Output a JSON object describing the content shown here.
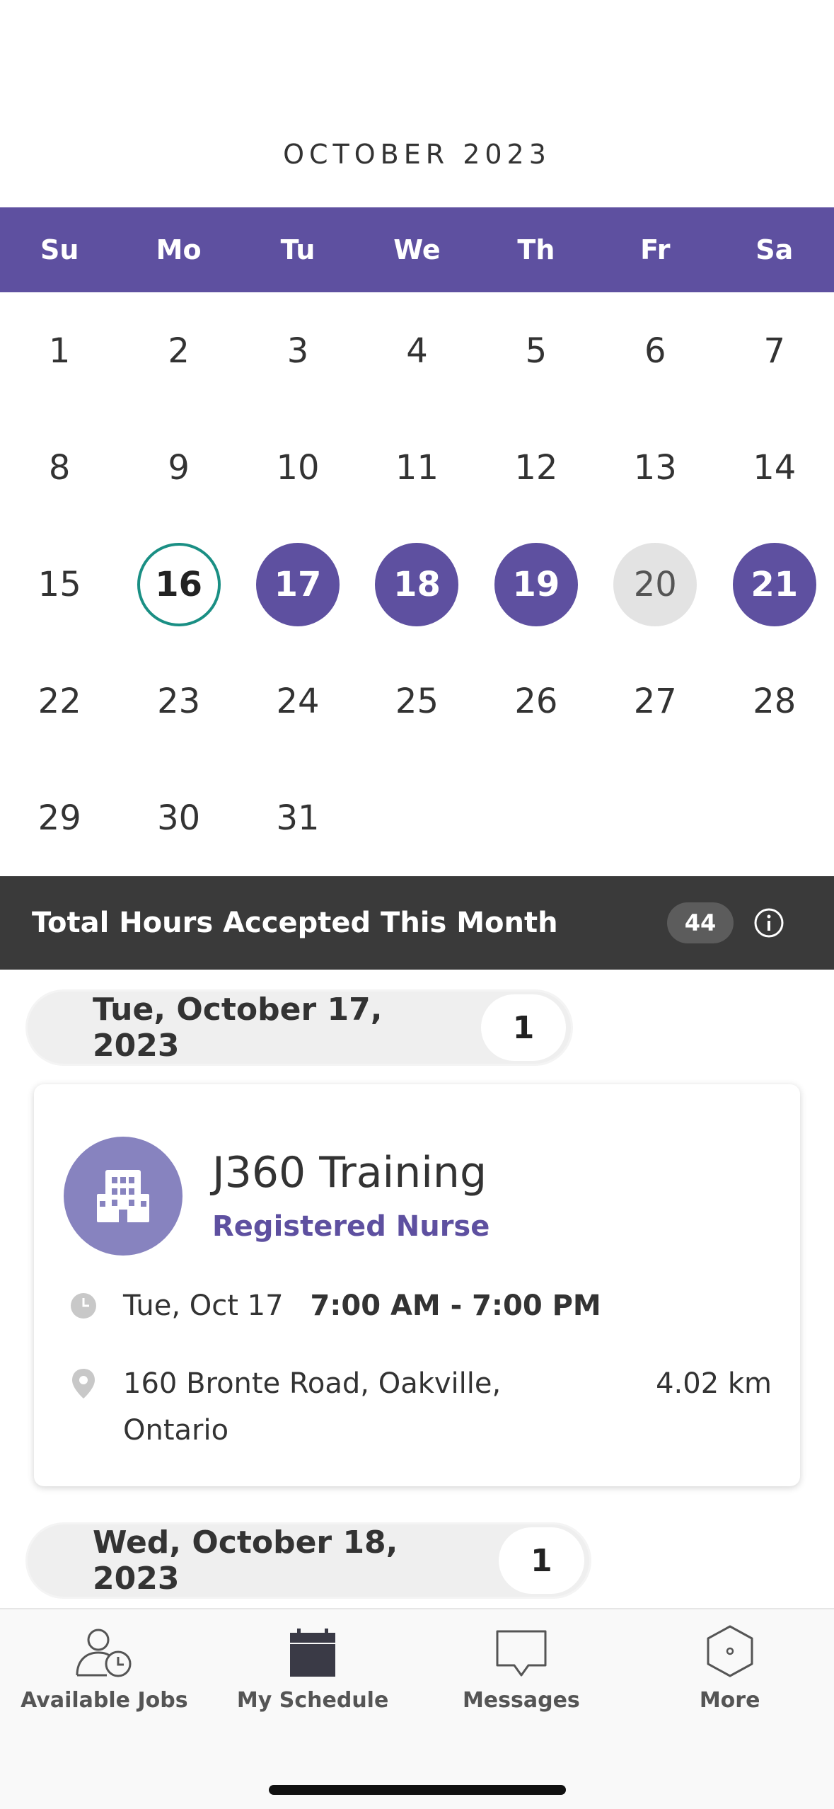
{
  "calendar": {
    "month_title": "OCTOBER 2023",
    "weekdays": [
      "Su",
      "Mo",
      "Tu",
      "We",
      "Th",
      "Fr",
      "Sa"
    ],
    "weeks": [
      [
        {
          "day": "1",
          "state": "none"
        },
        {
          "day": "2",
          "state": "none"
        },
        {
          "day": "3",
          "state": "none"
        },
        {
          "day": "4",
          "state": "none"
        },
        {
          "day": "5",
          "state": "none"
        },
        {
          "day": "6",
          "state": "none"
        },
        {
          "day": "7",
          "state": "none"
        }
      ],
      [
        {
          "day": "8",
          "state": "none"
        },
        {
          "day": "9",
          "state": "none"
        },
        {
          "day": "10",
          "state": "none"
        },
        {
          "day": "11",
          "state": "none"
        },
        {
          "day": "12",
          "state": "none"
        },
        {
          "day": "13",
          "state": "none"
        },
        {
          "day": "14",
          "state": "none"
        }
      ],
      [
        {
          "day": "15",
          "state": "none"
        },
        {
          "day": "16",
          "state": "today"
        },
        {
          "day": "17",
          "state": "booked"
        },
        {
          "day": "18",
          "state": "booked"
        },
        {
          "day": "19",
          "state": "booked"
        },
        {
          "day": "20",
          "state": "gray"
        },
        {
          "day": "21",
          "state": "booked"
        }
      ],
      [
        {
          "day": "22",
          "state": "none"
        },
        {
          "day": "23",
          "state": "none"
        },
        {
          "day": "24",
          "state": "none"
        },
        {
          "day": "25",
          "state": "none"
        },
        {
          "day": "26",
          "state": "none"
        },
        {
          "day": "27",
          "state": "none"
        },
        {
          "day": "28",
          "state": "none"
        }
      ],
      [
        {
          "day": "29",
          "state": "none"
        },
        {
          "day": "30",
          "state": "none"
        },
        {
          "day": "31",
          "state": "none"
        },
        {
          "day": "",
          "state": "empty"
        },
        {
          "day": "",
          "state": "empty"
        },
        {
          "day": "",
          "state": "empty"
        },
        {
          "day": "",
          "state": "empty"
        }
      ]
    ]
  },
  "hours_summary": {
    "label": "Total Hours Accepted This Month",
    "value": "44",
    "info_icon": "info-icon"
  },
  "schedule": {
    "groups": [
      {
        "date_label": "Tue, October 17, 2023",
        "count": "1",
        "shift": {
          "facility": "J360 Training",
          "role": "Registered Nurse",
          "date": "Tue, Oct 17",
          "time_range": "7:00 AM - 7:00 PM",
          "address": "160 Bronte Road, Oakville, Ontario",
          "distance": "4.02 km"
        }
      },
      {
        "date_label": "Wed, October 18, 2023",
        "count": "1"
      }
    ]
  },
  "tab_bar": {
    "tabs": [
      {
        "label": "Available Jobs",
        "icon": "person-clock-icon"
      },
      {
        "label": "My Schedule",
        "icon": "calendar-icon"
      },
      {
        "label": "Messages",
        "icon": "message-bubble-icon"
      },
      {
        "label": "More",
        "icon": "hexagon-icon"
      }
    ]
  },
  "colors": {
    "brand_purple": "#5e50a0",
    "today_ring": "#1a8f84",
    "hours_bar": "#3a3a3a",
    "avatar": "#8783bf"
  }
}
